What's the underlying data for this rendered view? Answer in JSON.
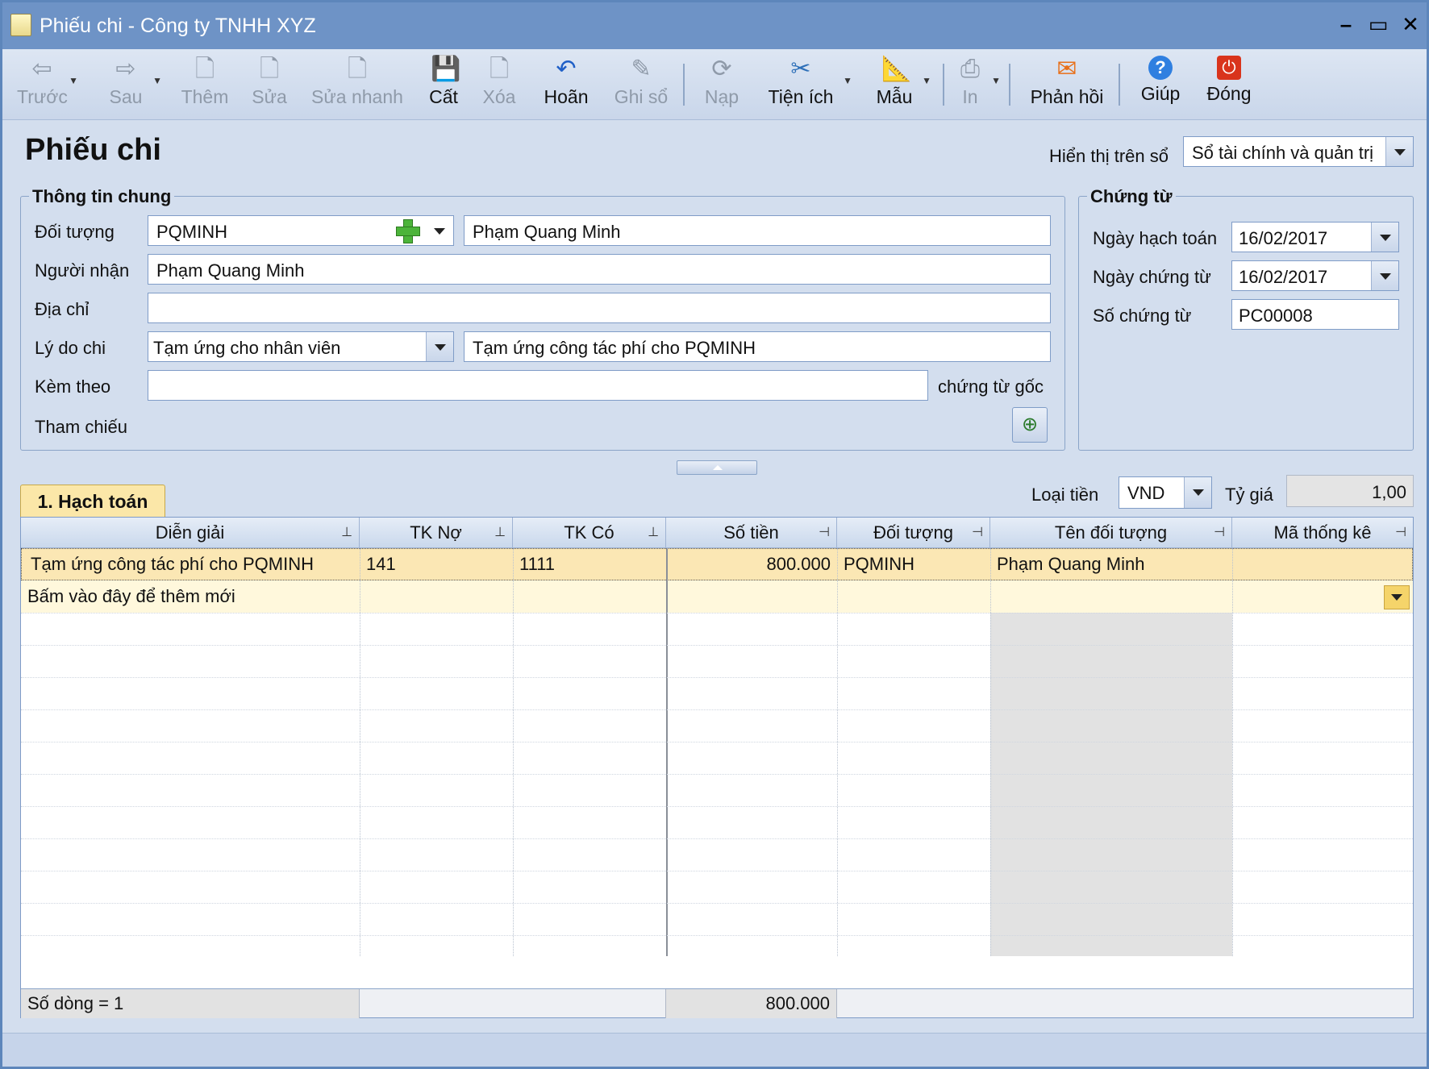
{
  "window": {
    "title": "Phiếu chi - Công ty TNHH XYZ",
    "minimize": "–",
    "maximize": "▭",
    "close": "✕"
  },
  "toolbar": [
    {
      "id": "prev",
      "label": "Trước",
      "icon": "arrow-left-icon",
      "glyph": "⇦",
      "enabled": false,
      "dropdown": true
    },
    {
      "id": "next",
      "label": "Sau",
      "icon": "arrow-right-icon",
      "glyph": "⇨",
      "enabled": false,
      "dropdown": true
    },
    {
      "id": "add",
      "label": "Thêm",
      "icon": "new-document-icon",
      "glyph": "🗋",
      "enabled": false
    },
    {
      "id": "edit",
      "label": "Sửa",
      "icon": "edit-document-icon",
      "glyph": "🗋",
      "enabled": false
    },
    {
      "id": "quick-edit",
      "label": "Sửa nhanh",
      "icon": "quick-edit-icon",
      "glyph": "🗋",
      "enabled": false
    },
    {
      "id": "save",
      "label": "Cất",
      "icon": "save-icon",
      "glyph": "💾",
      "enabled": true
    },
    {
      "id": "delete",
      "label": "Xóa",
      "icon": "delete-icon",
      "glyph": "🗋",
      "enabled": false
    },
    {
      "id": "undo",
      "label": "Hoãn",
      "icon": "undo-icon",
      "glyph": "↶",
      "enabled": true
    },
    {
      "id": "post",
      "label": "Ghi sổ",
      "icon": "pen-icon",
      "glyph": "✎",
      "enabled": false
    },
    {
      "id": "load",
      "label": "Nạp",
      "icon": "reload-icon",
      "glyph": "⟳",
      "enabled": false
    },
    {
      "id": "utilities",
      "label": "Tiện ích",
      "icon": "tools-icon",
      "glyph": "✂",
      "enabled": true,
      "dropdown": true
    },
    {
      "id": "template",
      "label": "Mẫu",
      "icon": "ruler-icon",
      "glyph": "📐",
      "enabled": true,
      "dropdown": true
    },
    {
      "id": "print",
      "label": "In",
      "icon": "printer-icon",
      "glyph": "⎙",
      "enabled": false,
      "dropdown": true
    },
    {
      "id": "feedback",
      "label": "Phản hồi",
      "icon": "mail-icon",
      "glyph": "✉",
      "enabled": true
    },
    {
      "id": "help",
      "label": "Giúp",
      "icon": "help-icon",
      "glyph": "?",
      "enabled": true
    },
    {
      "id": "close",
      "label": "Đóng",
      "icon": "power-icon",
      "glyph": "⏻",
      "enabled": true
    }
  ],
  "colors": {
    "toolbar_enabled": "#111111",
    "save": "#1f5fc7",
    "undo": "#1f5fc7",
    "feedback": "#e8701a",
    "help": "#2f7fe0",
    "close": "#d9341c",
    "tools": "#2d6fb8",
    "ruler": "#d48a10"
  },
  "form": {
    "title": "Phiếu chi",
    "display_label": "Hiển thị trên sổ",
    "display_value": "Sổ tài chính và quản trị"
  },
  "general": {
    "legend": "Thông tin chung",
    "object_label": "Đối tượng",
    "object_code": "PQMINH",
    "object_name": "Phạm Quang Minh",
    "receiver_label": "Người nhận",
    "receiver": "Phạm Quang Minh",
    "address_label": "Địa chỉ",
    "address": "",
    "reason_label": "Lý do chi",
    "reason_type": "Tạm ứng cho nhân viên",
    "reason_text": "Tạm ứng công tác phí cho PQMINH",
    "attach_label": "Kèm theo",
    "attach": "",
    "attach_suffix": "chứng từ gốc",
    "reference_label": "Tham chiếu"
  },
  "voucher": {
    "legend": "Chứng từ",
    "posting_date_label": "Ngày hạch toán",
    "posting_date": "16/02/2017",
    "voucher_date_label": "Ngày chứng từ",
    "voucher_date": "16/02/2017",
    "voucher_no_label": "Số chứng từ",
    "voucher_no": "PC00008"
  },
  "tab": {
    "label": "1. Hạch toán"
  },
  "currency": {
    "label": "Loại tiền",
    "value": "VND",
    "rate_label": "Tỷ giá",
    "rate": "1,00"
  },
  "grid": {
    "columns": [
      "Diễn giải",
      "TK Nợ",
      "TK Có",
      "Số tiền",
      "Đối tượng",
      "Tên đối tượng",
      "Mã thống kê"
    ],
    "rows": [
      [
        "Tạm ứng công tác phí cho PQMINH",
        "141",
        "1111",
        "800.000",
        "PQMINH",
        "Phạm Quang Minh",
        ""
      ]
    ],
    "new_row_hint": "Bấm vào đây để thêm mới",
    "footer_count": "Số dòng = 1",
    "footer_total": "800.000"
  }
}
